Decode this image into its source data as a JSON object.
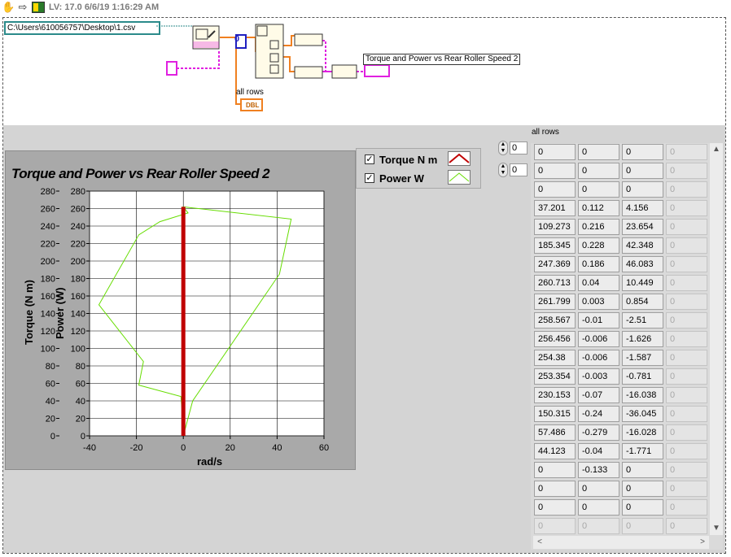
{
  "toolbar": {
    "hand_icon": "hand-icon",
    "arrow_icon": "arrow-icon",
    "vi_icon": "labview-vi-icon",
    "version": "LV: 17.0 6/6/19 1:16:29 AM"
  },
  "diagram": {
    "file_path": "C:\\Users\\610056757\\Desktop\\1.csv",
    "zero_const": "0",
    "all_rows_label": "all rows",
    "dbl_label": "DBL",
    "graph_terminal_label": "Torque and Power  vs  Rear Roller Speed 2",
    "colors": {
      "pink_wire": "#e020e0",
      "orange_wire": "#f08020",
      "blue_const": "#2020c0"
    }
  },
  "chart": {
    "title": "Torque and Power  vs  Rear Roller Speed 2",
    "y_tick_labels_torque": [
      "280",
      "260",
      "240",
      "220",
      "200",
      "180",
      "160",
      "140",
      "120",
      "100",
      "80",
      "60",
      "40",
      "20",
      "0"
    ],
    "y_tick_labels_power": [
      "280",
      "260",
      "240",
      "220",
      "200",
      "180",
      "160",
      "140",
      "120",
      "100",
      "80",
      "60",
      "40",
      "20",
      "0"
    ],
    "x_tick_labels": [
      "-40",
      "-20",
      "0",
      "20",
      "40",
      "60"
    ]
  },
  "chart_data": {
    "type": "line",
    "title": "Torque and Power  vs  Rear Roller Speed 2",
    "xlabel": "rad/s",
    "ylabel": "Torque (N m)",
    "y2label": "Power (W)",
    "xlim": [
      -40,
      60
    ],
    "ylim": [
      0,
      280
    ],
    "grid": true,
    "legend": "top-right",
    "series": [
      {
        "name": "Torque N m",
        "color": "#c00000",
        "x": [
          0,
          0,
          0,
          0,
          0,
          0,
          0,
          0,
          0,
          0,
          0,
          0,
          0,
          0,
          0,
          0,
          0
        ],
        "y": [
          0,
          1,
          3,
          8,
          15,
          25,
          40,
          60,
          85,
          110,
          140,
          170,
          200,
          225,
          245,
          255,
          262
        ]
      },
      {
        "name": "Power W",
        "color": "#66dd00",
        "x": [
          0,
          4,
          41,
          46,
          0,
          2,
          -10,
          -19,
          -36,
          -17,
          -19,
          -1,
          0,
          0
        ],
        "y": [
          0,
          40,
          185,
          248,
          262,
          255,
          245,
          230,
          150,
          85,
          58,
          45,
          10,
          0
        ]
      }
    ]
  },
  "legend": {
    "items": [
      {
        "label": "Torque N m",
        "checked": "✓",
        "color": "#c00000"
      },
      {
        "label": "Power W",
        "checked": "✓",
        "color": "#66dd00"
      }
    ]
  },
  "array": {
    "label": "all rows",
    "index_row": "0",
    "index_col": "0",
    "rows": [
      [
        "0",
        "0",
        "0",
        "0"
      ],
      [
        "0",
        "0",
        "0",
        "0"
      ],
      [
        "0",
        "0",
        "0",
        "0"
      ],
      [
        "37.201",
        "0.112",
        "4.156",
        "0"
      ],
      [
        "109.273",
        "0.216",
        "23.654",
        "0"
      ],
      [
        "185.345",
        "0.228",
        "42.348",
        "0"
      ],
      [
        "247.369",
        "0.186",
        "46.083",
        "0"
      ],
      [
        "260.713",
        "0.04",
        "10.449",
        "0"
      ],
      [
        "261.799",
        "0.003",
        "0.854",
        "0"
      ],
      [
        "258.567",
        "-0.01",
        "-2.51",
        "0"
      ],
      [
        "256.456",
        "-0.006",
        "-1.626",
        "0"
      ],
      [
        "254.38",
        "-0.006",
        "-1.587",
        "0"
      ],
      [
        "253.354",
        "-0.003",
        "-0.781",
        "0"
      ],
      [
        "230.153",
        "-0.07",
        "-16.038",
        "0"
      ],
      [
        "150.315",
        "-0.24",
        "-36.045",
        "0"
      ],
      [
        "57.486",
        "-0.279",
        "-16.028",
        "0"
      ],
      [
        "44.123",
        "-0.04",
        "-1.771",
        "0"
      ],
      [
        "0",
        "-0.133",
        "0",
        "0"
      ],
      [
        "0",
        "0",
        "0",
        "0"
      ],
      [
        "0",
        "0",
        "0",
        "0"
      ],
      [
        "0",
        "0",
        "0",
        "0"
      ]
    ],
    "scroll_up": "▲",
    "scroll_down": "▼",
    "scroll_left": "<",
    "scroll_right": ">"
  }
}
